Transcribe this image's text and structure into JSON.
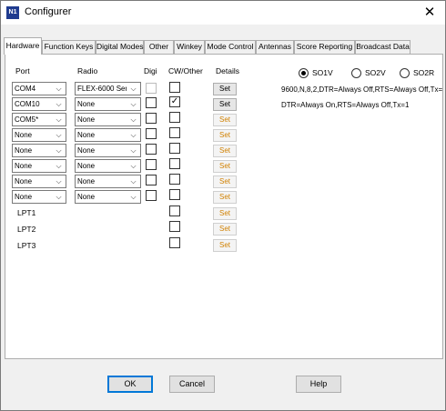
{
  "window": {
    "title": "Configurer",
    "icon_text": "N1"
  },
  "tabs": [
    "Hardware",
    "Function Keys",
    "Digital Modes",
    "Other",
    "Winkey",
    "Mode Control",
    "Antennas",
    "Score Reporting",
    "Broadcast Data"
  ],
  "headers": {
    "port": "Port",
    "radio": "Radio",
    "digi": "Digi",
    "cw": "CW/Other",
    "details": "Details"
  },
  "rows": [
    {
      "port": "COM4",
      "radio": "FLEX-6000 Seri",
      "digi": false,
      "cw": false
    },
    {
      "port": "COM10",
      "radio": "None",
      "digi": false,
      "cw": true
    },
    {
      "port": "COM5*",
      "radio": "None",
      "digi": false,
      "cw": false
    },
    {
      "port": "None",
      "radio": "None",
      "digi": false,
      "cw": false
    },
    {
      "port": "None",
      "radio": "None",
      "digi": false,
      "cw": false
    },
    {
      "port": "None",
      "radio": "None",
      "digi": false,
      "cw": false
    },
    {
      "port": "None",
      "radio": "None",
      "digi": false,
      "cw": false
    },
    {
      "port": "None",
      "radio": "None",
      "digi": false,
      "cw": false
    }
  ],
  "lpt": [
    "LPT1",
    "LPT2",
    "LPT3"
  ],
  "set_label": "Set",
  "radios": {
    "so1v": "SO1V",
    "so2v": "SO2V",
    "so2r": "SO2R",
    "selected": "SO1V"
  },
  "details_info": [
    "9600,N,8,2,DTR=Always Off,RTS=Always Off,Tx=1",
    "DTR=Always On,RTS=Always Off,Tx=1"
  ],
  "buttons": {
    "ok": "OK",
    "cancel": "Cancel",
    "help": "Help"
  },
  "colors": {
    "set_disabled_text": "#d08000",
    "default_button_border": "#0078d7"
  }
}
